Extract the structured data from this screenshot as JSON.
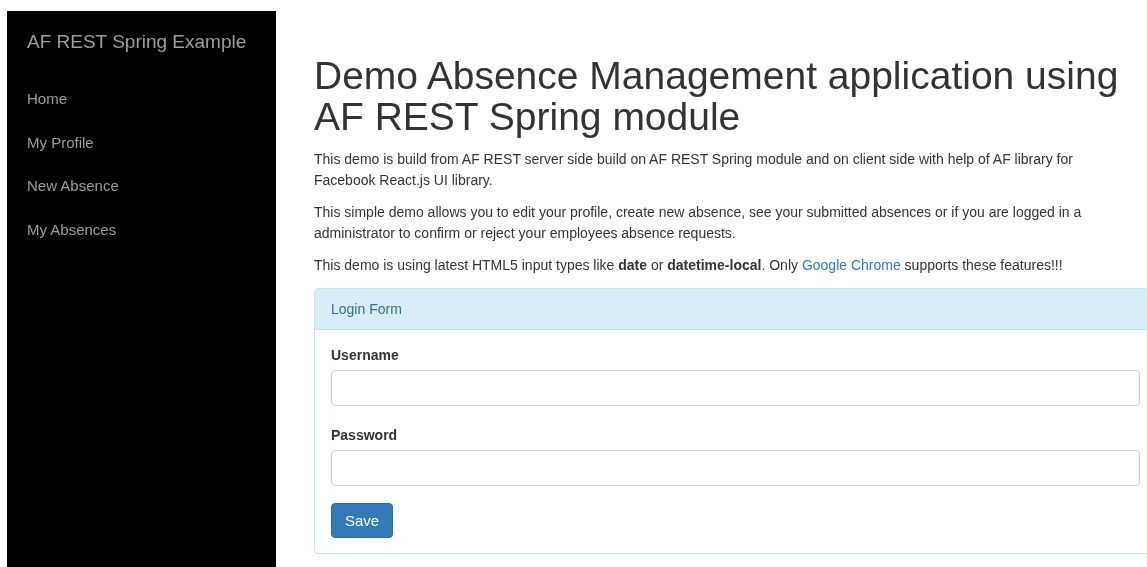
{
  "sidebar": {
    "brand": "AF REST Spring Example",
    "items": [
      {
        "label": "Home"
      },
      {
        "label": "My Profile"
      },
      {
        "label": "New Absence"
      },
      {
        "label": "My Absences"
      }
    ]
  },
  "heading": "Demo Absence Management application using AF REST Spring module",
  "paragraphs": [
    {
      "lines": [
        "This demo is build from AF REST server side build on AF REST Spring module and on client side with help of AF library for",
        "Facebook React.js UI library."
      ]
    },
    {
      "lines": [
        "This simple demo allows you to edit your profile, create new absence, see your submitted absences or if you are logged in a",
        "administrator to confirm or reject your employees absence requests."
      ]
    },
    {
      "lines": [
        "This demo is using latest HTML5 input types like **date** or **datetime-local**. Only "
      ],
      "link": "Google Chrome",
      "after": " supports these features!!!"
    }
  ],
  "login_form": {
    "title": "Login Form",
    "fields": [
      {
        "label": "Username"
      },
      {
        "label": "Password"
      }
    ],
    "button": "Save"
  }
}
